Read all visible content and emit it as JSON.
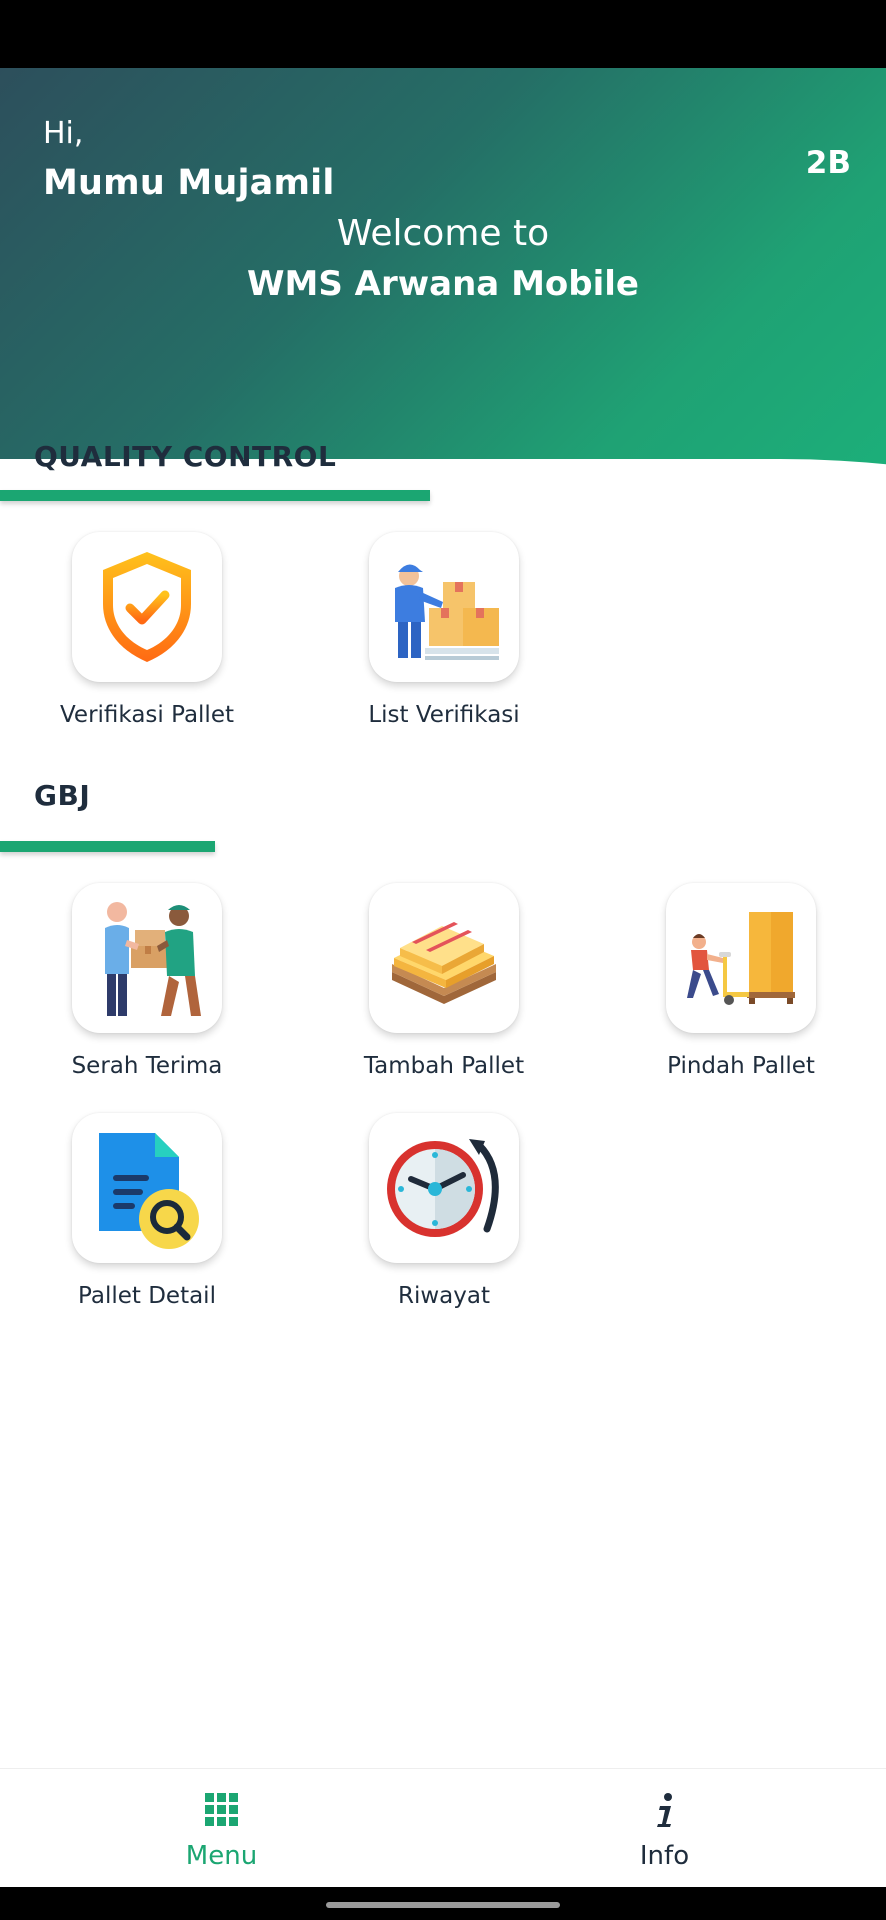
{
  "header": {
    "greeting": "Hi,",
    "user_name": "Mumu Mujamil",
    "shift": "2B",
    "welcome": "Welcome to",
    "app_name": "WMS Arwana Mobile"
  },
  "sections": {
    "quality_control": {
      "title": "QUALITY CONTROL",
      "items": [
        {
          "label": "Verifikasi Pallet",
          "icon": "shield-check-icon"
        },
        {
          "label": "List Verifikasi",
          "icon": "worker-boxes-icon"
        }
      ]
    },
    "gbj": {
      "title": "GBJ",
      "items": [
        {
          "label": "Serah Terima",
          "icon": "handover-icon"
        },
        {
          "label": "Tambah Pallet",
          "icon": "pallet-boxes-icon"
        },
        {
          "label": "Pindah Pallet",
          "icon": "pallet-jack-icon"
        },
        {
          "label": "Pallet Detail",
          "icon": "document-search-icon"
        },
        {
          "label": "Riwayat",
          "icon": "history-clock-icon"
        }
      ]
    }
  },
  "nav": {
    "items": [
      {
        "label": "Menu",
        "icon": "grid-icon",
        "active": true
      },
      {
        "label": "Info",
        "icon": "info-icon",
        "active": false
      }
    ]
  },
  "colors": {
    "accent": "#1ba672",
    "header_start": "#2d4f5c",
    "header_end": "#1cb07a",
    "text_dark": "#1f2d3d"
  }
}
